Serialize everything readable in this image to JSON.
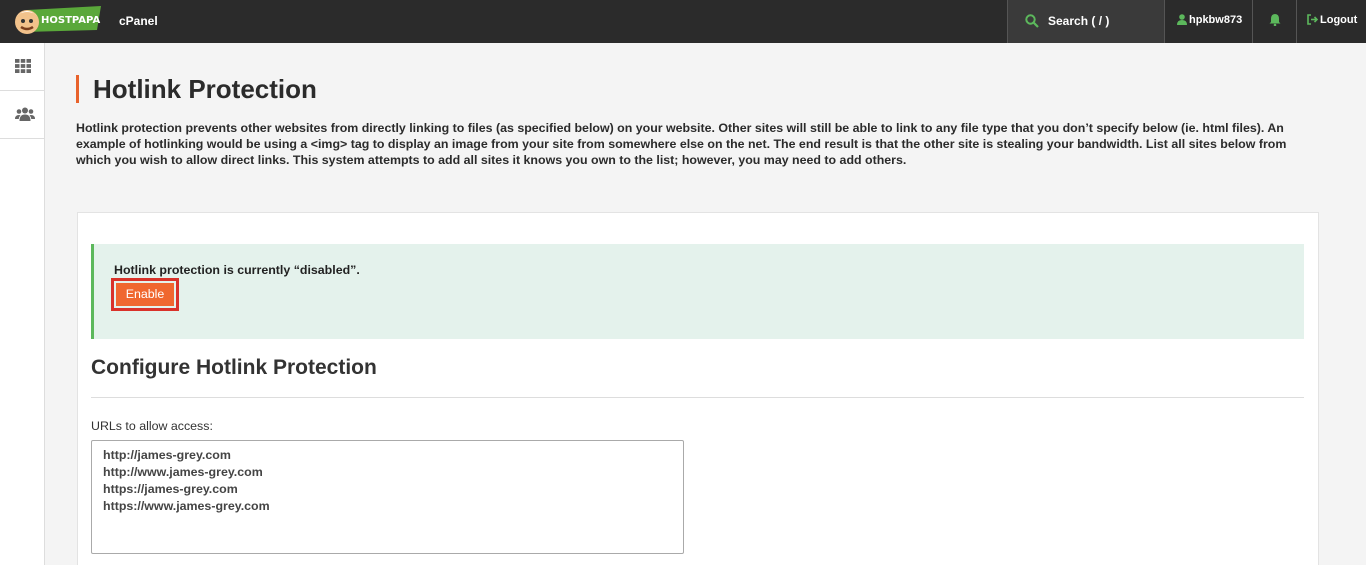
{
  "topbar": {
    "logo_text": "HOSTPAPA",
    "app_name": "cPanel",
    "search_placeholder": "Search ( / )",
    "username": "hpkbw873",
    "logout_label": "Logout"
  },
  "sidebar": {
    "items": [
      {
        "icon": "grid-icon"
      },
      {
        "icon": "users-icon"
      }
    ]
  },
  "page": {
    "title": "Hotlink Protection",
    "description": "Hotlink protection prevents other websites from directly linking to files (as specified below) on your website. Other sites will still be able to link to any file type that you don’t specify below (ie. html files). An example of hotlinking would be using a <img> tag to display an image from your site from somewhere else on the net. The end result is that the other site is stealing your bandwidth. List all sites below from which you wish to allow direct links. This system attempts to add all sites it knows you own to the list; however, you may need to add others."
  },
  "status": {
    "message": "Hotlink protection is currently “disabled”.",
    "enable_label": "Enable"
  },
  "config": {
    "title": "Configure Hotlink Protection",
    "urls_label": "URLs to allow access:",
    "urls": [
      "http://james-grey.com",
      "http://www.james-grey.com",
      "https://james-grey.com",
      "https://www.james-grey.com"
    ]
  },
  "colors": {
    "accent": "#f0672f",
    "topbar": "#2b2b2b",
    "success_bg": "#e4f2ec",
    "success_border": "#5cb85c",
    "highlight": "#d9322a"
  }
}
